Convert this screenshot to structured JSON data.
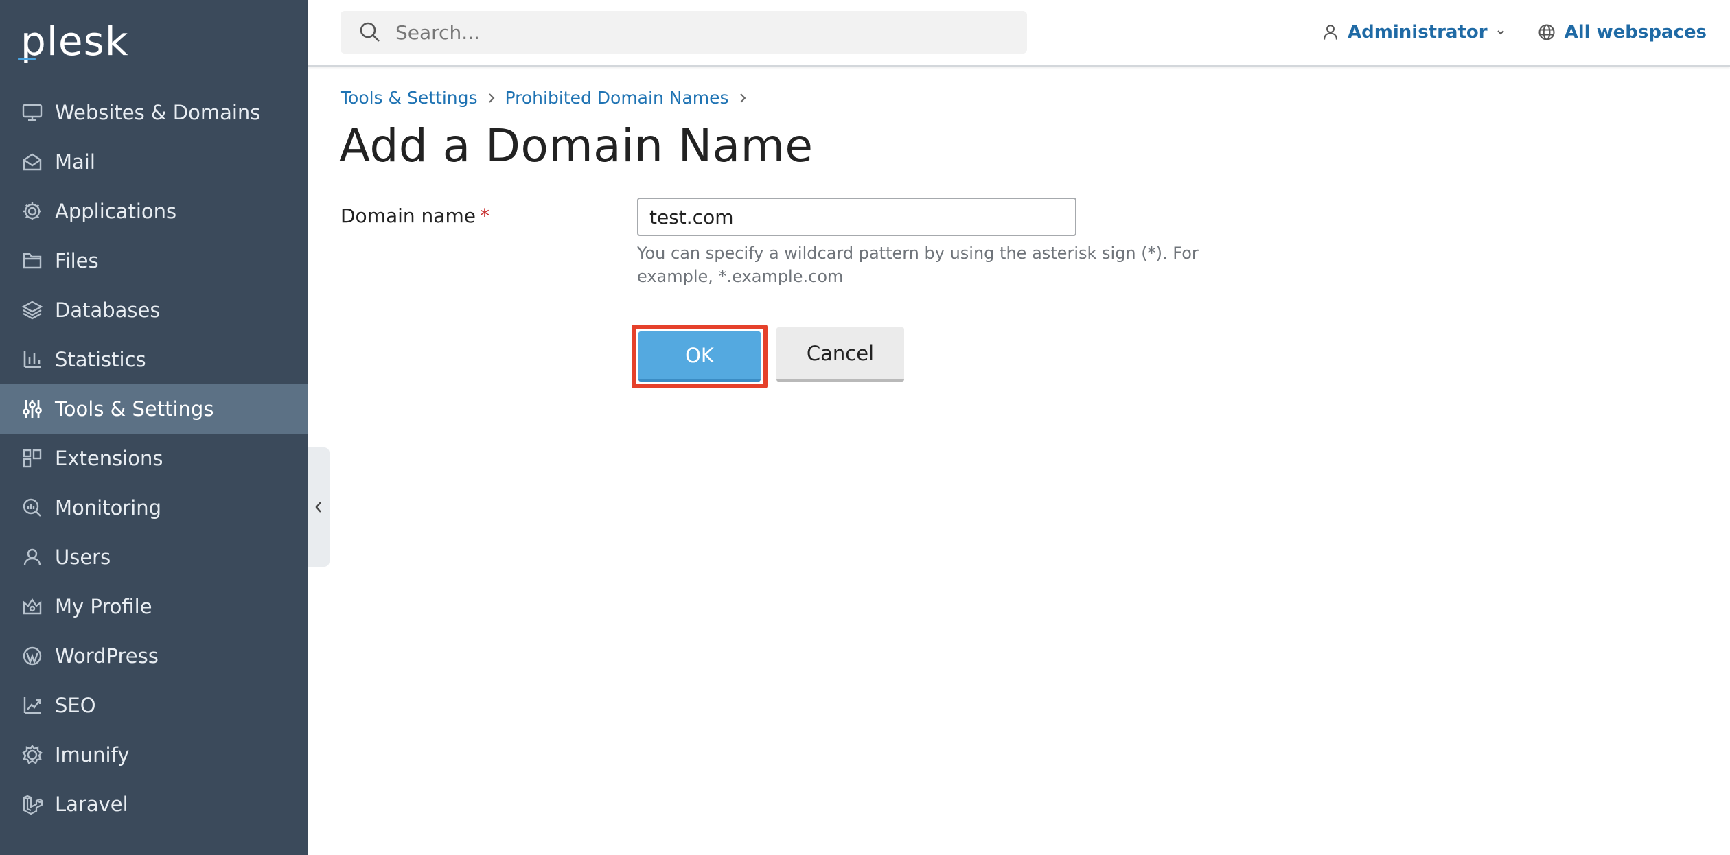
{
  "app": {
    "logo": "plesk",
    "accent_color": "#4aa3df",
    "sidebar_color": "#3b4a5b",
    "active_color": "#5c7185"
  },
  "sidebar": {
    "items": [
      {
        "label": "Websites & Domains",
        "icon": "monitor-icon"
      },
      {
        "label": "Mail",
        "icon": "mail-icon"
      },
      {
        "label": "Applications",
        "icon": "gear-icon"
      },
      {
        "label": "Files",
        "icon": "folder-icon"
      },
      {
        "label": "Databases",
        "icon": "layers-icon"
      },
      {
        "label": "Statistics",
        "icon": "bar-chart-icon"
      },
      {
        "label": "Tools & Settings",
        "icon": "sliders-icon",
        "active": true
      },
      {
        "label": "Extensions",
        "icon": "grid-icon"
      },
      {
        "label": "Monitoring",
        "icon": "magnifier-chart-icon"
      },
      {
        "label": "Users",
        "icon": "user-icon"
      },
      {
        "label": "My Profile",
        "icon": "crown-icon"
      },
      {
        "label": "WordPress",
        "icon": "wordpress-icon"
      },
      {
        "label": "SEO",
        "icon": "trend-icon"
      },
      {
        "label": "Imunify",
        "icon": "shield-gear-icon"
      },
      {
        "label": "Laravel",
        "icon": "laravel-icon"
      }
    ]
  },
  "topbar": {
    "search_placeholder": "Search...",
    "user_label": "Administrator",
    "webspaces_label": "All webspaces"
  },
  "breadcrumb": {
    "items": [
      "Tools & Settings",
      "Prohibited Domain Names"
    ]
  },
  "page": {
    "title": "Add a Domain Name"
  },
  "form": {
    "domain_label": "Domain name",
    "required_mark": "*",
    "domain_value": "test.com",
    "hint": "You can specify a wildcard pattern by using the asterisk sign (*). For example, *.example.com",
    "ok_label": "OK",
    "cancel_label": "Cancel"
  }
}
